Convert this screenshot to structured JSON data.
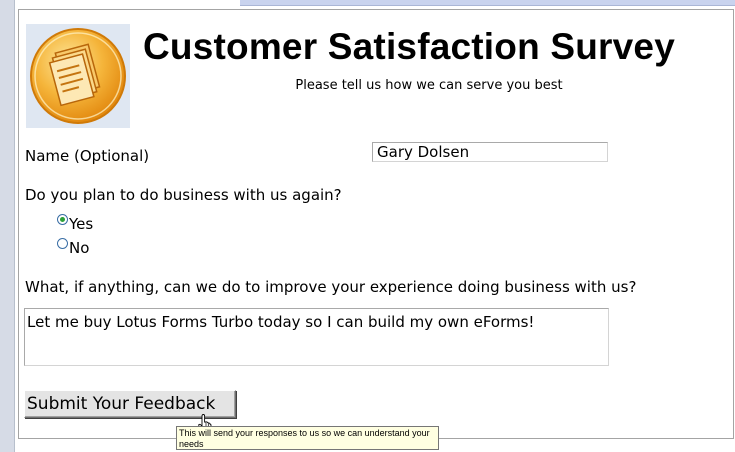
{
  "survey": {
    "title": "Customer Satisfaction Survey",
    "subtitle": "Please tell us how we can serve you best",
    "logo_icon": "document-stack-icon"
  },
  "name_field": {
    "label": "Name (Optional)",
    "value": "Gary Dolsen"
  },
  "business_question": {
    "label": "Do you plan to do business with us again?",
    "options": [
      {
        "label": "Yes",
        "selected": true
      },
      {
        "label": "No",
        "selected": false
      }
    ]
  },
  "improve_question": {
    "label": "What, if anything, can we do to improve your experience doing business with us?",
    "value": "Let me buy Lotus Forms Turbo today so I can build my own eForms!"
  },
  "submit": {
    "label": "Submit Your Feedback",
    "tooltip": "This will send your responses to us so we can understand your needs"
  },
  "colors": {
    "logo_orange": "#f2a21b",
    "radio_selected": "#2da13a",
    "tooltip_bg": "#ffffe1"
  }
}
